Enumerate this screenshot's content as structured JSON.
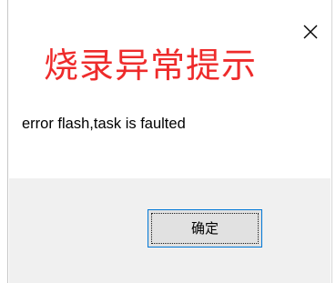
{
  "dialog": {
    "heading": "烧录异常提示",
    "message": "error flash,task is faulted",
    "ok_label": "确定"
  },
  "colors": {
    "heading": "#ee2b2b",
    "footer_background": "#f0f0f0",
    "button_border": "#0078d7",
    "button_background": "#e1e1e1"
  },
  "icons": {
    "close": "close-icon"
  }
}
